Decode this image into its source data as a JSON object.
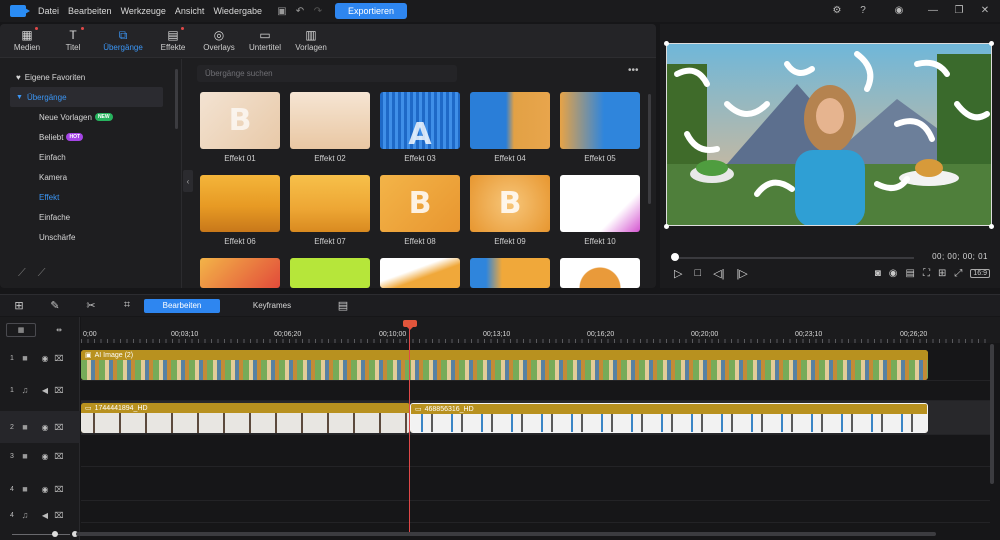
{
  "menu": {
    "items": [
      "Datei",
      "Bearbeiten",
      "Werkzeuge",
      "Ansicht",
      "Wiedergabe"
    ],
    "export_label": "Exportieren"
  },
  "library": {
    "tabs": [
      {
        "label": "Medien",
        "icon": "media-icon",
        "dot": true
      },
      {
        "label": "Titel",
        "icon": "title-icon",
        "dot": true
      },
      {
        "label": "Übergänge",
        "icon": "transition-icon",
        "dot": false,
        "active": true
      },
      {
        "label": "Effekte",
        "icon": "effects-icon",
        "dot": true
      },
      {
        "label": "Overlays",
        "icon": "overlays-icon",
        "dot": false
      },
      {
        "label": "Untertitel",
        "icon": "subtitle-icon",
        "dot": false
      },
      {
        "label": "Vorlagen",
        "icon": "templates-icon",
        "dot": false
      }
    ],
    "sidebar": {
      "favorites": "Eigene Favoriten",
      "section": "Übergänge",
      "items": [
        "Neue Vorlagen",
        "Beliebt",
        "Einfach",
        "Kamera",
        "Effekt",
        "Einfache",
        "Unschärfe"
      ],
      "badge_new": "NEW",
      "badge_hot": "HOT"
    },
    "search_placeholder": "Übergänge suchen",
    "tiles": [
      "Effekt 01",
      "Effekt 02",
      "Effekt 03",
      "Effekt 04",
      "Effekt 05",
      "Effekt 06",
      "Effekt 07",
      "Effekt 08",
      "Effekt 09",
      "Effekt 10"
    ]
  },
  "preview": {
    "timecode": "00; 00; 00; 01",
    "ratio": "16:9"
  },
  "timeline": {
    "tabs": [
      "Bearbeiten",
      "Keyframes"
    ],
    "ruler": [
      "0;00",
      "00;03;10",
      "00;06;20",
      "00;10;00",
      "00;13;10",
      "00;16;20",
      "00;20;00",
      "00;23;10",
      "00;26;20"
    ],
    "tracks": [
      "1",
      "1",
      "2",
      "3",
      "4",
      "4"
    ],
    "clips": {
      "ai_image": "AI Image (2)",
      "video_a": "1744441894_HD",
      "video_b": "468856316_HD"
    }
  },
  "colors": {
    "accent": "#2e86f0",
    "clip_gold": "#b8911f",
    "playhead": "#e04848"
  }
}
